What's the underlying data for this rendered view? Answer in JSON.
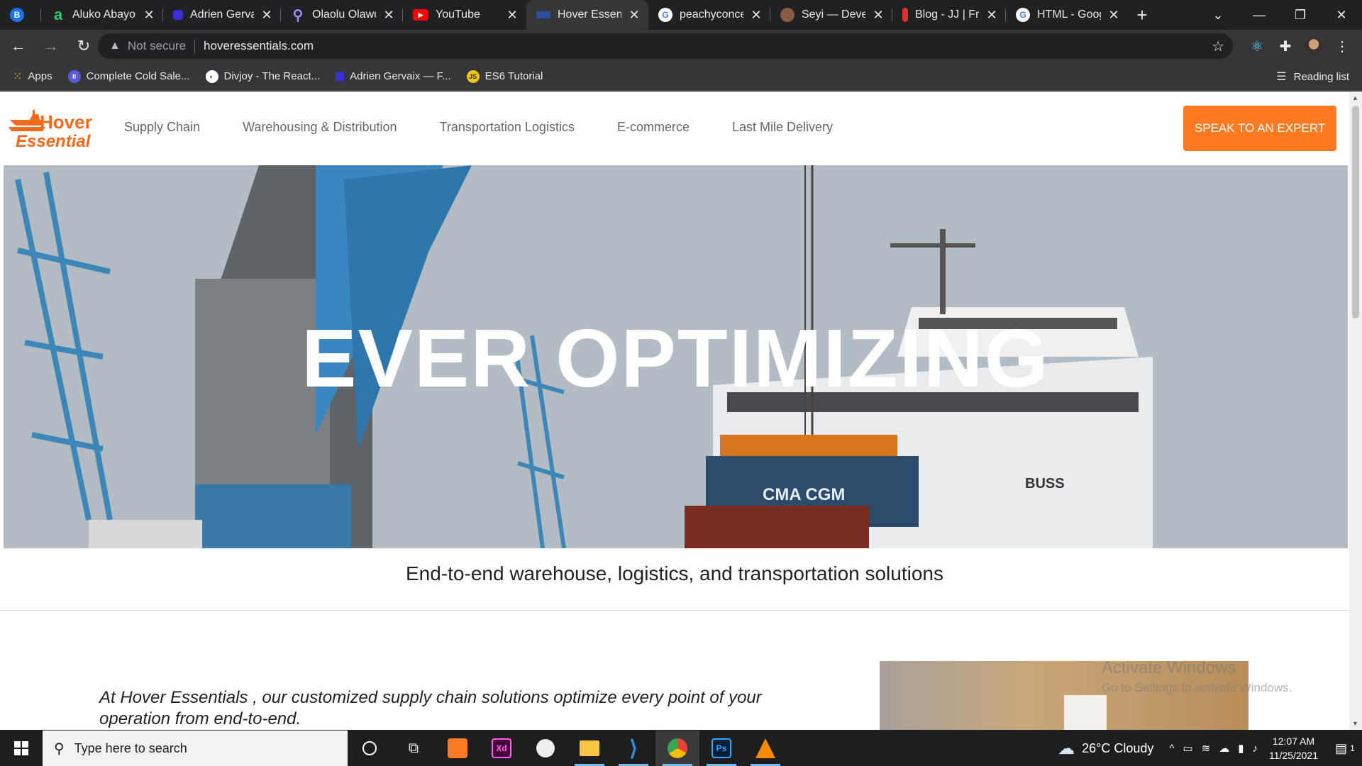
{
  "browser": {
    "tabs": [
      {
        "title": "",
        "favicon": "B",
        "favicon_color": "#1a73e8",
        "active": false
      },
      {
        "title": "Aluko Abayomi",
        "favicon": "a",
        "favicon_color": "#2ecc71",
        "active": false
      },
      {
        "title": "Adrien Gervaix",
        "favicon": "",
        "favicon_color": "#3b2fd9",
        "active": false
      },
      {
        "title": "Olaolu Olawuyi",
        "favicon": "",
        "favicon_color": "#a78bfa",
        "active": false
      },
      {
        "title": "YouTube",
        "favicon": "▶",
        "favicon_color": "#ff0000",
        "active": false
      },
      {
        "title": "Hover Essentials",
        "favicon": "",
        "favicon_color": "#2b4f9a",
        "active": true
      },
      {
        "title": "peachyconcept",
        "favicon": "G",
        "favicon_color": "#ffffff",
        "active": false
      },
      {
        "title": "Seyi — Developer",
        "favicon": "",
        "favicon_color": "#8a5a44",
        "active": false
      },
      {
        "title": "Blog - JJ | Front",
        "favicon": "",
        "favicon_color": "#e03131",
        "active": false
      },
      {
        "title": "HTML - Google",
        "favicon": "G",
        "favicon_color": "#ffffff",
        "active": false
      }
    ],
    "new_tab": "+",
    "address": {
      "security": "Not secure",
      "url": "hoveressentials.com"
    },
    "bookmarks": [
      {
        "label": "Apps",
        "color": "#4285f4"
      },
      {
        "label": "Complete Cold Sale...",
        "color": "#5b5bd6"
      },
      {
        "label": "Divjoy - The React...",
        "color": "#ffffff"
      },
      {
        "label": "Adrien Gervaix — F...",
        "color": "#3b2fd9"
      },
      {
        "label": "ES6 Tutorial",
        "color": "#f0c419"
      }
    ],
    "reading_list": "Reading list"
  },
  "site": {
    "logo_line1": "Hover",
    "logo_line2": "Essential",
    "nav": [
      "Supply Chain",
      "Warehousing & Distribution",
      "Transportation Logistics",
      "E-commerce",
      "Last Mile Delivery"
    ],
    "cta": "SPEAK TO AN EXPERT",
    "hero_title": "EVER OPTIMIZING",
    "hero_container_text": "CMA CGM",
    "hero_ship_text": "BUSS",
    "tagline": "End-to-end warehouse, logistics, and transportation solutions",
    "intro": "At Hover Essentials , our customized supply chain solutions optimize every point of your operation from end-to-end.",
    "watermark_title": "Activate Windows",
    "watermark_sub": "Go to Settings to activate Windows."
  },
  "taskbar": {
    "search_placeholder": "Type here to search",
    "weather": "26°C  Cloudy",
    "time": "12:07 AM",
    "date": "11/25/2021",
    "notifications": "1"
  },
  "colors": {
    "accent": "#ff7a21",
    "nav_text": "#666666"
  }
}
